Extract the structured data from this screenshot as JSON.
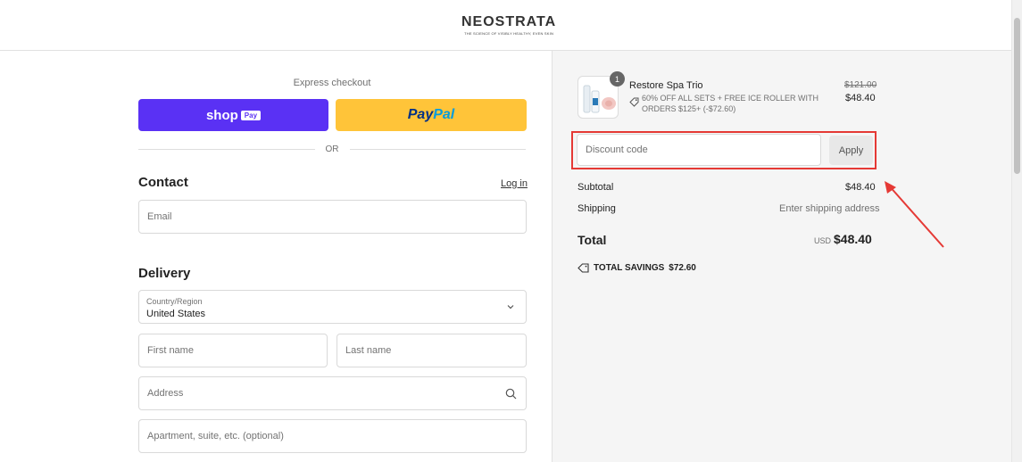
{
  "header": {
    "logo_text": "NEOSTRATA",
    "logo_tagline": "THE SCIENCE OF VISIBLY HEALTHY, EVEN SKIN"
  },
  "express": {
    "label": "Express checkout",
    "shoppay": {
      "word": "shop",
      "badge": "Pay",
      "color": "#5a31f4"
    },
    "paypal": {
      "part1": "Pay",
      "part2": "Pal",
      "color": "#ffc439"
    },
    "or_label": "OR"
  },
  "contact": {
    "heading": "Contact",
    "login_link": "Log in",
    "email_placeholder": "Email"
  },
  "delivery": {
    "heading": "Delivery",
    "country_label": "Country/Region",
    "country_value": "United States",
    "first_name_placeholder": "First name",
    "last_name_placeholder": "Last name",
    "address_placeholder": "Address",
    "apartment_placeholder": "Apartment, suite, etc. (optional)"
  },
  "order": {
    "quantity": "1",
    "product_name": "Restore Spa Trio",
    "discount_text": "60% OFF ALL SETS + FREE ICE ROLLER WITH ORDERS $125+ (-$72.60)",
    "price_original": "$121.00",
    "price_current": "$48.40"
  },
  "discount": {
    "placeholder": "Discount code",
    "apply_label": "Apply",
    "highlight_color": "#e53935"
  },
  "summary": {
    "subtotal_label": "Subtotal",
    "subtotal_value": "$48.40",
    "shipping_label": "Shipping",
    "shipping_value": "Enter shipping address",
    "total_label": "Total",
    "total_currency": "USD",
    "total_value": "$48.40",
    "savings_label": "TOTAL SAVINGS",
    "savings_value": "$72.60"
  }
}
